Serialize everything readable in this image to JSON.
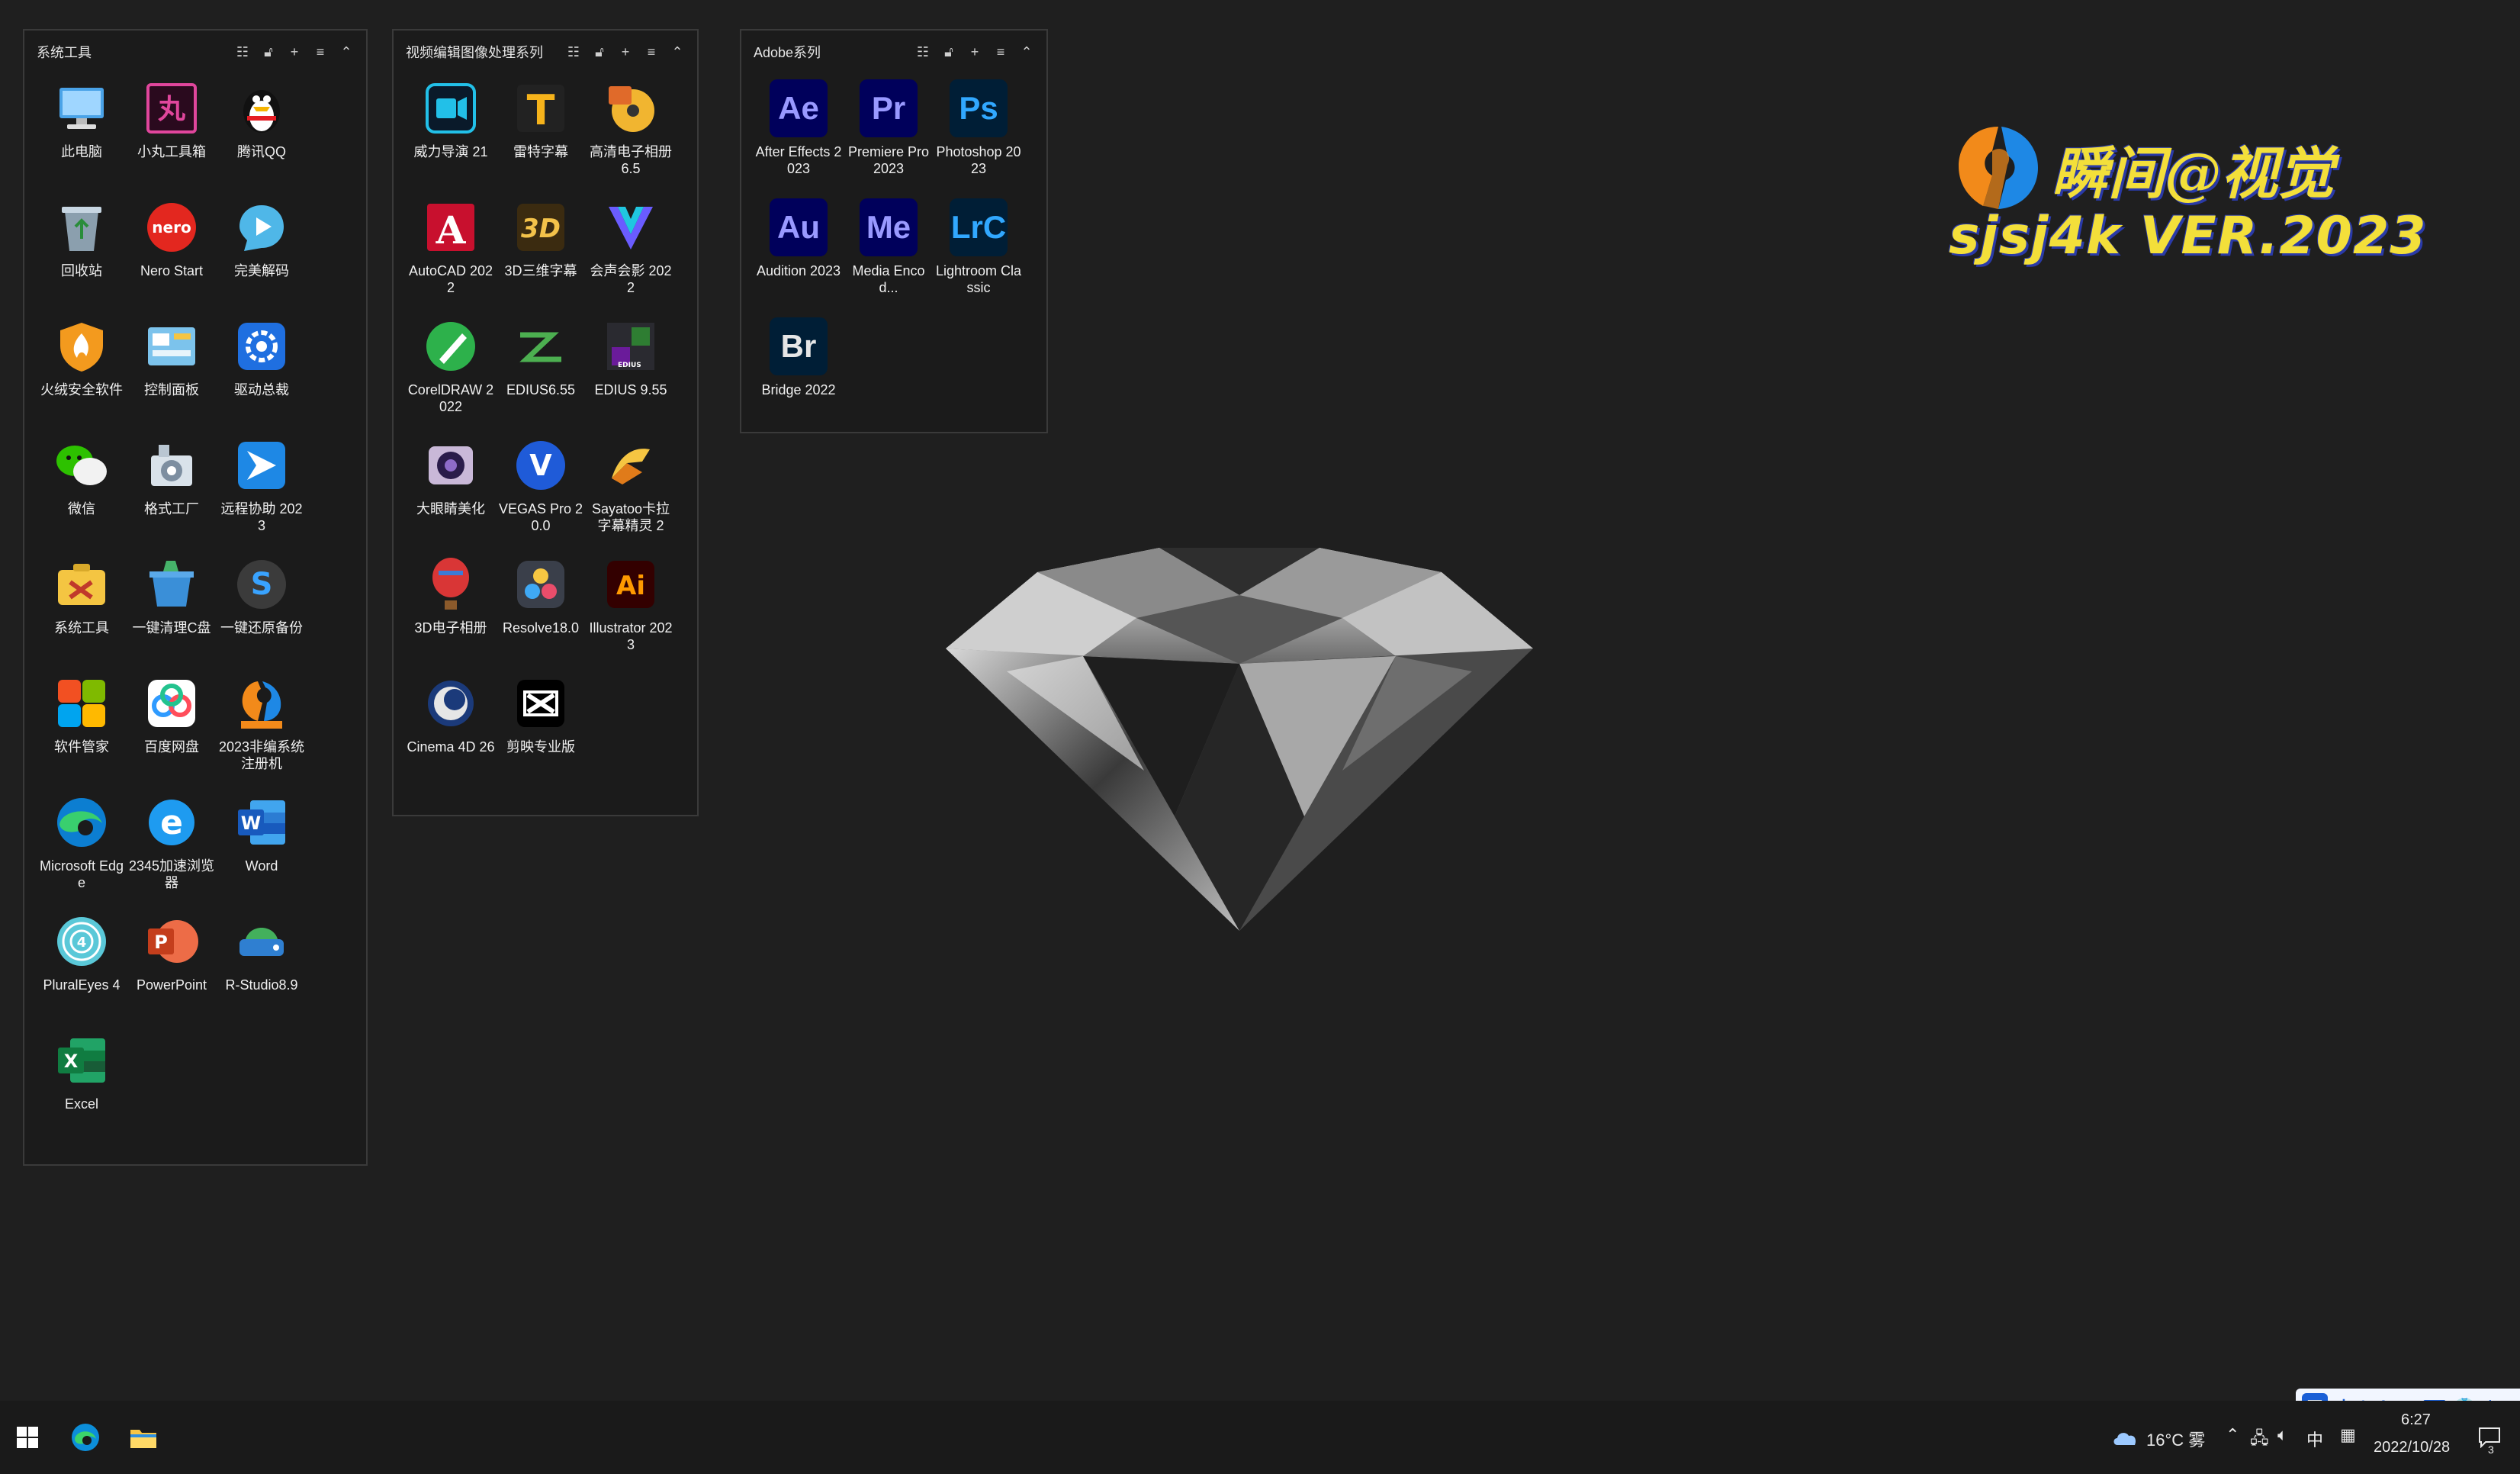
{
  "fences": {
    "system": {
      "title": "系统工具",
      "items": [
        {
          "label": "此电脑",
          "icon": "computer-icon"
        },
        {
          "label": "小丸工具箱",
          "icon": "xiaowan-toolbox-icon"
        },
        {
          "label": "腾讯QQ",
          "icon": "qq-penguin-icon"
        },
        {
          "label": "回收站",
          "icon": "recycle-bin-icon"
        },
        {
          "label": "Nero Start",
          "icon": "nero-icon"
        },
        {
          "label": "完美解码",
          "icon": "play-bubble-icon"
        },
        {
          "label": "火绒安全软件",
          "icon": "shield-icon"
        },
        {
          "label": "控制面板",
          "icon": "control-panel-icon"
        },
        {
          "label": "驱动总裁",
          "icon": "driver-gear-icon"
        },
        {
          "label": "微信",
          "icon": "wechat-icon"
        },
        {
          "label": "格式工厂",
          "icon": "format-factory-icon"
        },
        {
          "label": "远程协助 2023",
          "icon": "remote-assist-icon"
        },
        {
          "label": "系统工具",
          "icon": "tools-box-icon"
        },
        {
          "label": "一键清理C盘",
          "icon": "cleanup-bin-icon"
        },
        {
          "label": "一键还原备份",
          "icon": "restore-s-icon"
        },
        {
          "label": "软件管家",
          "icon": "app-grid-icon"
        },
        {
          "label": "百度网盘",
          "icon": "baidu-cloud-icon"
        },
        {
          "label": "2023非编系统注册机",
          "icon": "keygen-icon"
        },
        {
          "label": "Microsoft Edge",
          "icon": "edge-icon"
        },
        {
          "label": "2345加速浏览器",
          "icon": "ie-browser-icon"
        },
        {
          "label": "Word",
          "icon": "word-icon"
        },
        {
          "label": "PluralEyes 4",
          "icon": "pluraleyes-icon"
        },
        {
          "label": "PowerPoint",
          "icon": "powerpoint-icon"
        },
        {
          "label": "R-Studio8.9",
          "icon": "rstudio-drive-icon"
        },
        {
          "label": "Excel",
          "icon": "excel-icon"
        }
      ]
    },
    "video": {
      "title": "视频编辑图像处理系列",
      "items": [
        {
          "label": "威力导演 21",
          "icon": "powerdirector-icon"
        },
        {
          "label": "雷特字幕",
          "icon": "title-t-icon"
        },
        {
          "label": "高清电子相册 6.5",
          "icon": "photo-album-disc-icon"
        },
        {
          "label": "AutoCAD 2022",
          "icon": "autocad-icon"
        },
        {
          "label": "3D三维字幕",
          "icon": "3d-text-icon"
        },
        {
          "label": "会声会影 2022",
          "icon": "videostudio-v-icon"
        },
        {
          "label": "CorelDRAW 2022",
          "icon": "coreldraw-icon"
        },
        {
          "label": "EDIUS6.55",
          "icon": "edius6-icon"
        },
        {
          "label": "EDIUS 9.55",
          "icon": "edius9-icon"
        },
        {
          "label": "大眼睛美化",
          "icon": "eye-beautify-icon"
        },
        {
          "label": "VEGAS Pro 20.0",
          "icon": "vegas-v-icon"
        },
        {
          "label": "Sayatoo卡拉字幕精灵 2",
          "icon": "sayatoo-icon"
        },
        {
          "label": "3D电子相册",
          "icon": "balloon-album-icon"
        },
        {
          "label": "Resolve18.0",
          "icon": "davinci-resolve-icon"
        },
        {
          "label": "Illustrator 2023",
          "icon": "illustrator-icon"
        },
        {
          "label": "Cinema 4D 26",
          "icon": "cinema4d-icon"
        },
        {
          "label": "剪映专业版",
          "icon": "capcut-icon"
        }
      ]
    },
    "adobe": {
      "title": "Adobe系列",
      "items": [
        {
          "label": "After Effects 2023",
          "abbr": "Ae",
          "fg": "#9999ff",
          "bg": "#00005b"
        },
        {
          "label": "Premiere Pro 2023",
          "abbr": "Pr",
          "fg": "#9999ff",
          "bg": "#00005b"
        },
        {
          "label": "Photoshop 2023",
          "abbr": "Ps",
          "fg": "#31a8ff",
          "bg": "#001e36"
        },
        {
          "label": "Audition 2023",
          "abbr": "Au",
          "fg": "#9999ff",
          "bg": "#00005b"
        },
        {
          "label": "Media Encod...",
          "abbr": "Me",
          "fg": "#9999ff",
          "bg": "#00005b"
        },
        {
          "label": "Lightroom Classic",
          "abbr": "LrC",
          "fg": "#31a8ff",
          "bg": "#001e36"
        },
        {
          "label": "Bridge 2022",
          "abbr": "Br",
          "fg": "#e6e6e6",
          "bg": "#001e36"
        }
      ]
    }
  },
  "watermark": {
    "cn": "瞬间@视觉",
    "en": "sjsj4k VER.2023"
  },
  "taskbar": {
    "pinned": [
      "start-windows-icon",
      "edge-icon",
      "file-explorer-icon"
    ],
    "weather": "16°C 雾",
    "ime": "中",
    "time": "6:27",
    "date": "2022/10/28",
    "notification_count": "3"
  },
  "ime_toolbar": {
    "items": [
      "王",
      "中",
      "°,",
      "✎",
      "✂",
      "⌨",
      "👕",
      "⚙"
    ]
  }
}
